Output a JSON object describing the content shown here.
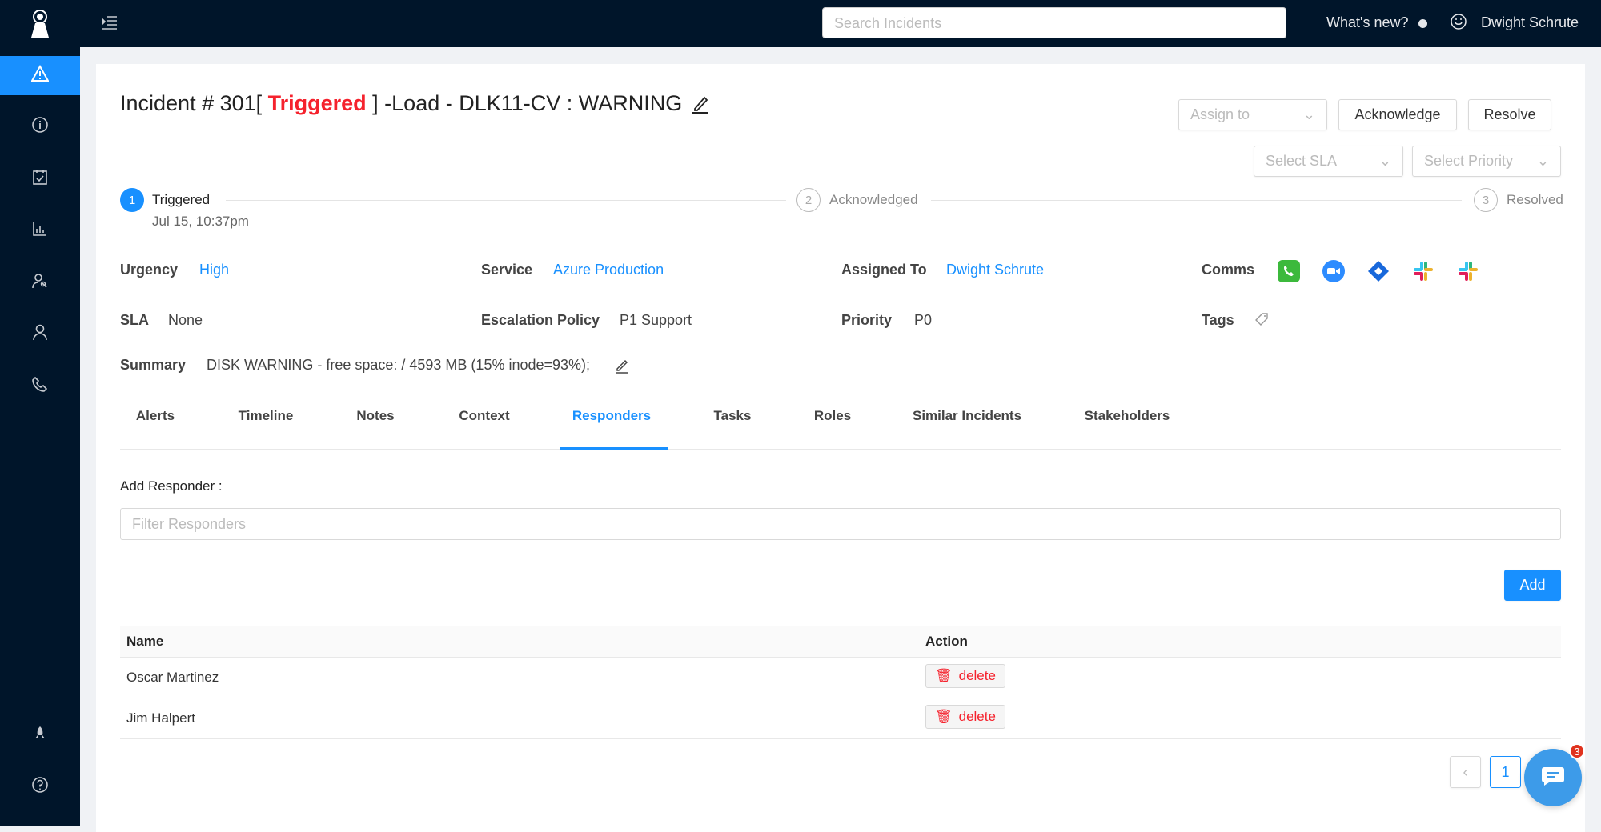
{
  "topbar": {
    "search_placeholder": "Search Incidents",
    "whats_new": "What's new?",
    "user": "Dwight Schrute"
  },
  "incident": {
    "prefix": "Incident # 301[ ",
    "status": "Triggered",
    "suffix": " ] -Load - DLK11-CV : WARNING",
    "status_color": "#f5222d"
  },
  "actions": {
    "assign": "Assign to",
    "acknowledge": "Acknowledge",
    "resolve": "Resolve",
    "sla": "Select SLA",
    "priority": "Select Priority"
  },
  "steps": [
    {
      "num": "1",
      "label": "Triggered",
      "time": "Jul 15, 10:37pm"
    },
    {
      "num": "2",
      "label": "Acknowledged"
    },
    {
      "num": "3",
      "label": "Resolved"
    }
  ],
  "fields": {
    "urgency_label": "Urgency",
    "urgency": "High",
    "service_label": "Service",
    "service": "Azure Production",
    "assigned_label": "Assigned To",
    "assigned": "Dwight Schrute",
    "comms_label": "Comms",
    "sla_label": "SLA",
    "sla": "None",
    "escalation_label": "Escalation Policy",
    "escalation": "P1 Support",
    "priority_label": "Priority",
    "priority": "P0",
    "tags_label": "Tags",
    "summary_label": "Summary",
    "summary": "DISK WARNING - free space: / 4593 MB (15% inode=93%);"
  },
  "tabs": [
    "Alerts",
    "Timeline",
    "Notes",
    "Context",
    "Responders",
    "Tasks",
    "Roles",
    "Similar Incidents",
    "Stakeholders"
  ],
  "responders": {
    "add_label": "Add Responder :",
    "filter_placeholder": "Filter Responders",
    "add_button": "Add",
    "columns": [
      "Name",
      "Action"
    ],
    "rows": [
      {
        "name": "Oscar Martinez",
        "action": "delete"
      },
      {
        "name": "Jim Halpert",
        "action": "delete"
      }
    ]
  },
  "pagination": {
    "page": "1"
  },
  "chat": {
    "badge": "3"
  }
}
